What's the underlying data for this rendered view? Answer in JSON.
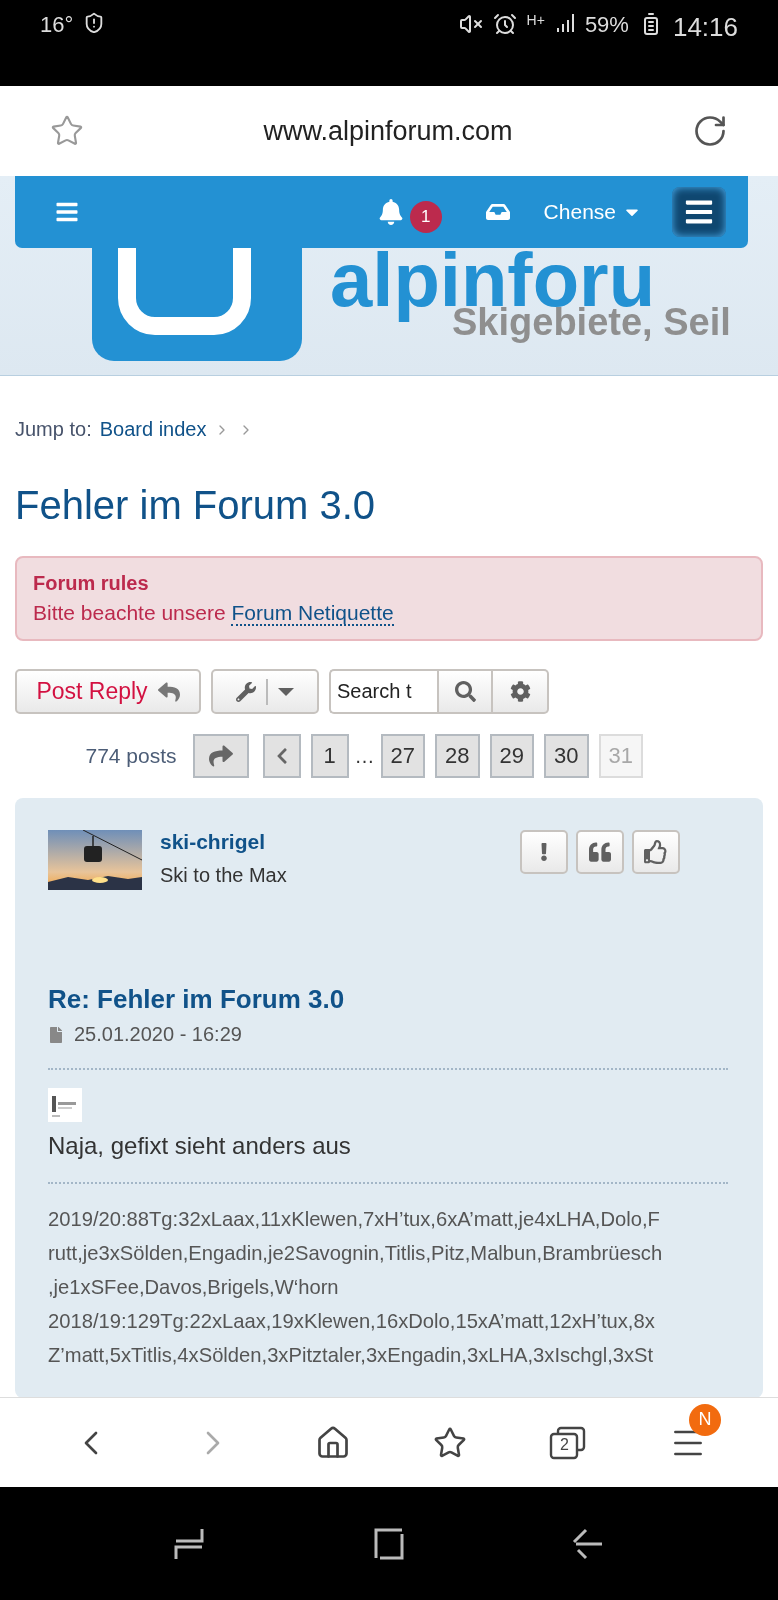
{
  "status_bar": {
    "temperature": "16°",
    "network": "H+",
    "battery": "59%",
    "time": "14:16"
  },
  "browser": {
    "url": "www.alpinforum.com"
  },
  "navbar": {
    "notification_count": "1",
    "username": "Chense"
  },
  "banner": {
    "wordmark": "alpinforu",
    "tagline": "Skigebiete, Seil"
  },
  "breadcrumb": {
    "label": "Jump to:",
    "link": "Board index"
  },
  "topic_title": "Fehler im Forum 3.0",
  "rules": {
    "title": "Forum rules",
    "text": "Bitte beachte unsere",
    "link": "Forum Netiquette"
  },
  "actions": {
    "post_reply": "Post Reply",
    "search_placeholder": "Search t"
  },
  "pagination": {
    "total": "774 posts",
    "pages": [
      {
        "kind": "page",
        "label": "1",
        "selected": false
      },
      {
        "kind": "ellipsis",
        "label": "…"
      },
      {
        "kind": "page",
        "label": "27",
        "selected": false
      },
      {
        "kind": "page",
        "label": "28",
        "selected": false
      },
      {
        "kind": "page",
        "label": "29",
        "selected": false
      },
      {
        "kind": "page",
        "label": "30",
        "selected": false
      },
      {
        "kind": "page",
        "label": "31",
        "selected": true
      }
    ]
  },
  "post": {
    "author": "ski-chrigel",
    "rank": "Ski to the Max",
    "subject": "Re: Fehler im Forum 3.0",
    "date": "25.01.2020 - 16:29",
    "body": "Naja, gefixt sieht anders aus",
    "signature_lines": [
      "2019/20:88Tg:32xLaax,11xKlewen,7xH’tux,6xA’matt,je4xLHA,Dolo,F",
      "rutt,je3xSölden,Engadin,je2Savognin,Titlis,Pitz,Malbun,Brambrüesch",
      ",je1xSFee,Davos,Brigels,W‘horn",
      "2018/19:129Tg:22xLaax,19xKlewen,16xDolo,15xA’matt,12xH’tux,8x",
      "Z’matt,5xTitlis,4xSölden,3xPitztaler,3xEngadin,3xLHA,3xIschgl,3xSt"
    ]
  },
  "bottom_nav": {
    "forward": {
      "disabled": true
    },
    "tab_count": "2",
    "menu_badge": "N"
  }
}
